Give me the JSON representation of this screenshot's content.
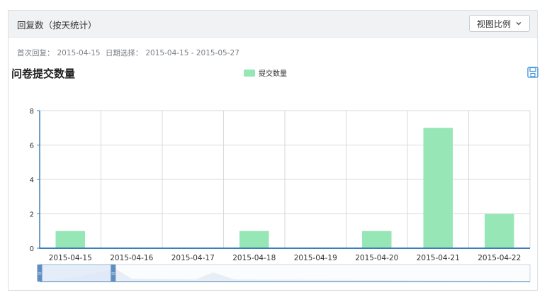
{
  "panel": {
    "title": "回复数（按天统计）",
    "view_button_label": "视图比例"
  },
  "meta": {
    "first_reply_label": "首次回复：",
    "first_reply_value": "2015-04-15",
    "date_range_label": "日期选择：",
    "date_range_value": "2015-04-15 - 2015-05-27"
  },
  "icons": {
    "view_dropdown": "chevron-down-icon",
    "save": "save-icon"
  },
  "colors": {
    "bar": "#97e6b6",
    "axis": "#3b7fb8",
    "grid": "#d9d9d9",
    "header_bg": "#f1f2f4"
  },
  "chart_data": {
    "type": "bar",
    "title": "问卷提交数量",
    "categories": [
      "2015-04-15",
      "2015-04-16",
      "2015-04-17",
      "2015-04-18",
      "2015-04-19",
      "2015-04-20",
      "2015-04-21",
      "2015-04-22"
    ],
    "series": [
      {
        "name": "提交数量",
        "values": [
          1,
          0,
          0,
          1,
          0,
          1,
          7,
          2
        ]
      }
    ],
    "yticks": [
      "0",
      "2",
      "4",
      "6",
      "8"
    ],
    "ylim": [
      0,
      8
    ],
    "legend": "top-center",
    "grid": true,
    "zoom_slider": {
      "start_fraction": 0.0,
      "end_fraction": 0.15
    }
  }
}
